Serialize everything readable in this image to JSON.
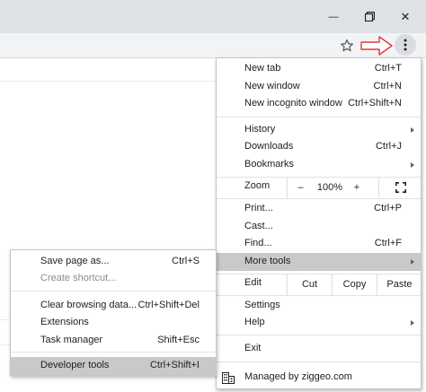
{
  "window": {
    "minimize_glyph": "—",
    "close_glyph": "✕"
  },
  "toolbar": {
    "bookmark_icon": "star-outline-icon",
    "menu_icon": "three-dots-vertical-icon",
    "annotation_arrow_color": "#e53935"
  },
  "main_menu": {
    "new_tab": {
      "label": "New tab",
      "shortcut": "Ctrl+T"
    },
    "new_window": {
      "label": "New window",
      "shortcut": "Ctrl+N"
    },
    "new_incognito": {
      "label": "New incognito window",
      "shortcut": "Ctrl+Shift+N"
    },
    "history": {
      "label": "History"
    },
    "downloads": {
      "label": "Downloads",
      "shortcut": "Ctrl+J"
    },
    "bookmarks": {
      "label": "Bookmarks"
    },
    "zoom": {
      "label": "Zoom",
      "minus": "–",
      "level": "100%",
      "plus": "+"
    },
    "print": {
      "label": "Print...",
      "shortcut": "Ctrl+P"
    },
    "cast": {
      "label": "Cast..."
    },
    "find": {
      "label": "Find...",
      "shortcut": "Ctrl+F"
    },
    "more_tools": {
      "label": "More tools"
    },
    "edit": {
      "label": "Edit",
      "cut": "Cut",
      "copy": "Copy",
      "paste": "Paste"
    },
    "settings": {
      "label": "Settings"
    },
    "help": {
      "label": "Help"
    },
    "exit": {
      "label": "Exit"
    },
    "managed": {
      "label": "Managed by ziggeo.com"
    }
  },
  "more_tools_menu": {
    "save_page": {
      "label": "Save page as...",
      "shortcut": "Ctrl+S"
    },
    "create_shortcut": {
      "label": "Create shortcut..."
    },
    "clear_data": {
      "label": "Clear browsing data...",
      "shortcut": "Ctrl+Shift+Del"
    },
    "extensions": {
      "label": "Extensions"
    },
    "task_manager": {
      "label": "Task manager",
      "shortcut": "Shift+Esc"
    },
    "developer_tools": {
      "label": "Developer tools",
      "shortcut": "Ctrl+Shift+I"
    }
  },
  "colors": {
    "highlight": "#c9c9c9",
    "chrome_bg": "#dee1e6",
    "toolbar_bg": "#f1f3f4"
  }
}
